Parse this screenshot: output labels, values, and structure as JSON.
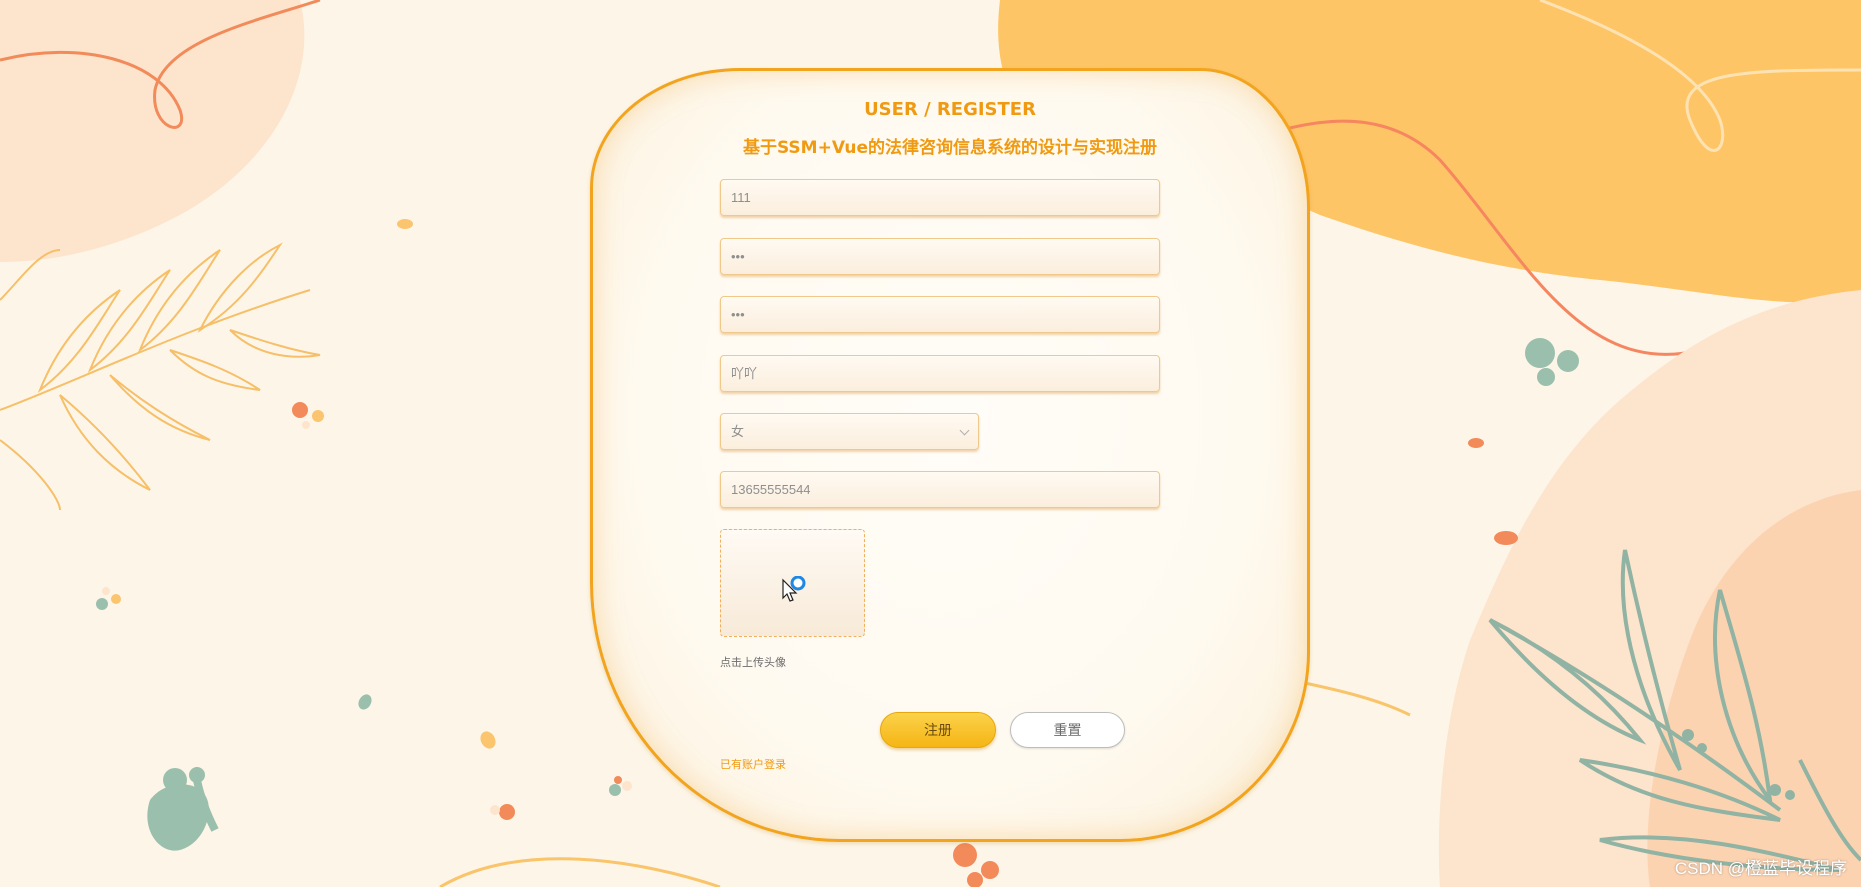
{
  "form": {
    "title": "USER / REGISTER",
    "subtitle": "基于SSM+Vue的法律咨询信息系统的设计与实现注册",
    "fields": {
      "account": "111",
      "password": "•••",
      "confirm_password": "•••",
      "name": "吖吖",
      "gender": "女",
      "phone": "13655555544"
    },
    "upload_hint": "点击上传头像",
    "register_button": "注册",
    "reset_button": "重置",
    "login_link": "已有账户登录"
  },
  "icons": {
    "select_arrow": "chevron-down-icon",
    "cursor": "mouse-cursor-icon",
    "loading": "loading-spinner-icon"
  },
  "colors": {
    "accent": "#f09a12",
    "card_border": "#f2a41e",
    "button_yellow": "#f5b514",
    "background": "#fdf6e8"
  },
  "watermark": "CSDN @橙蓝毕设程序"
}
